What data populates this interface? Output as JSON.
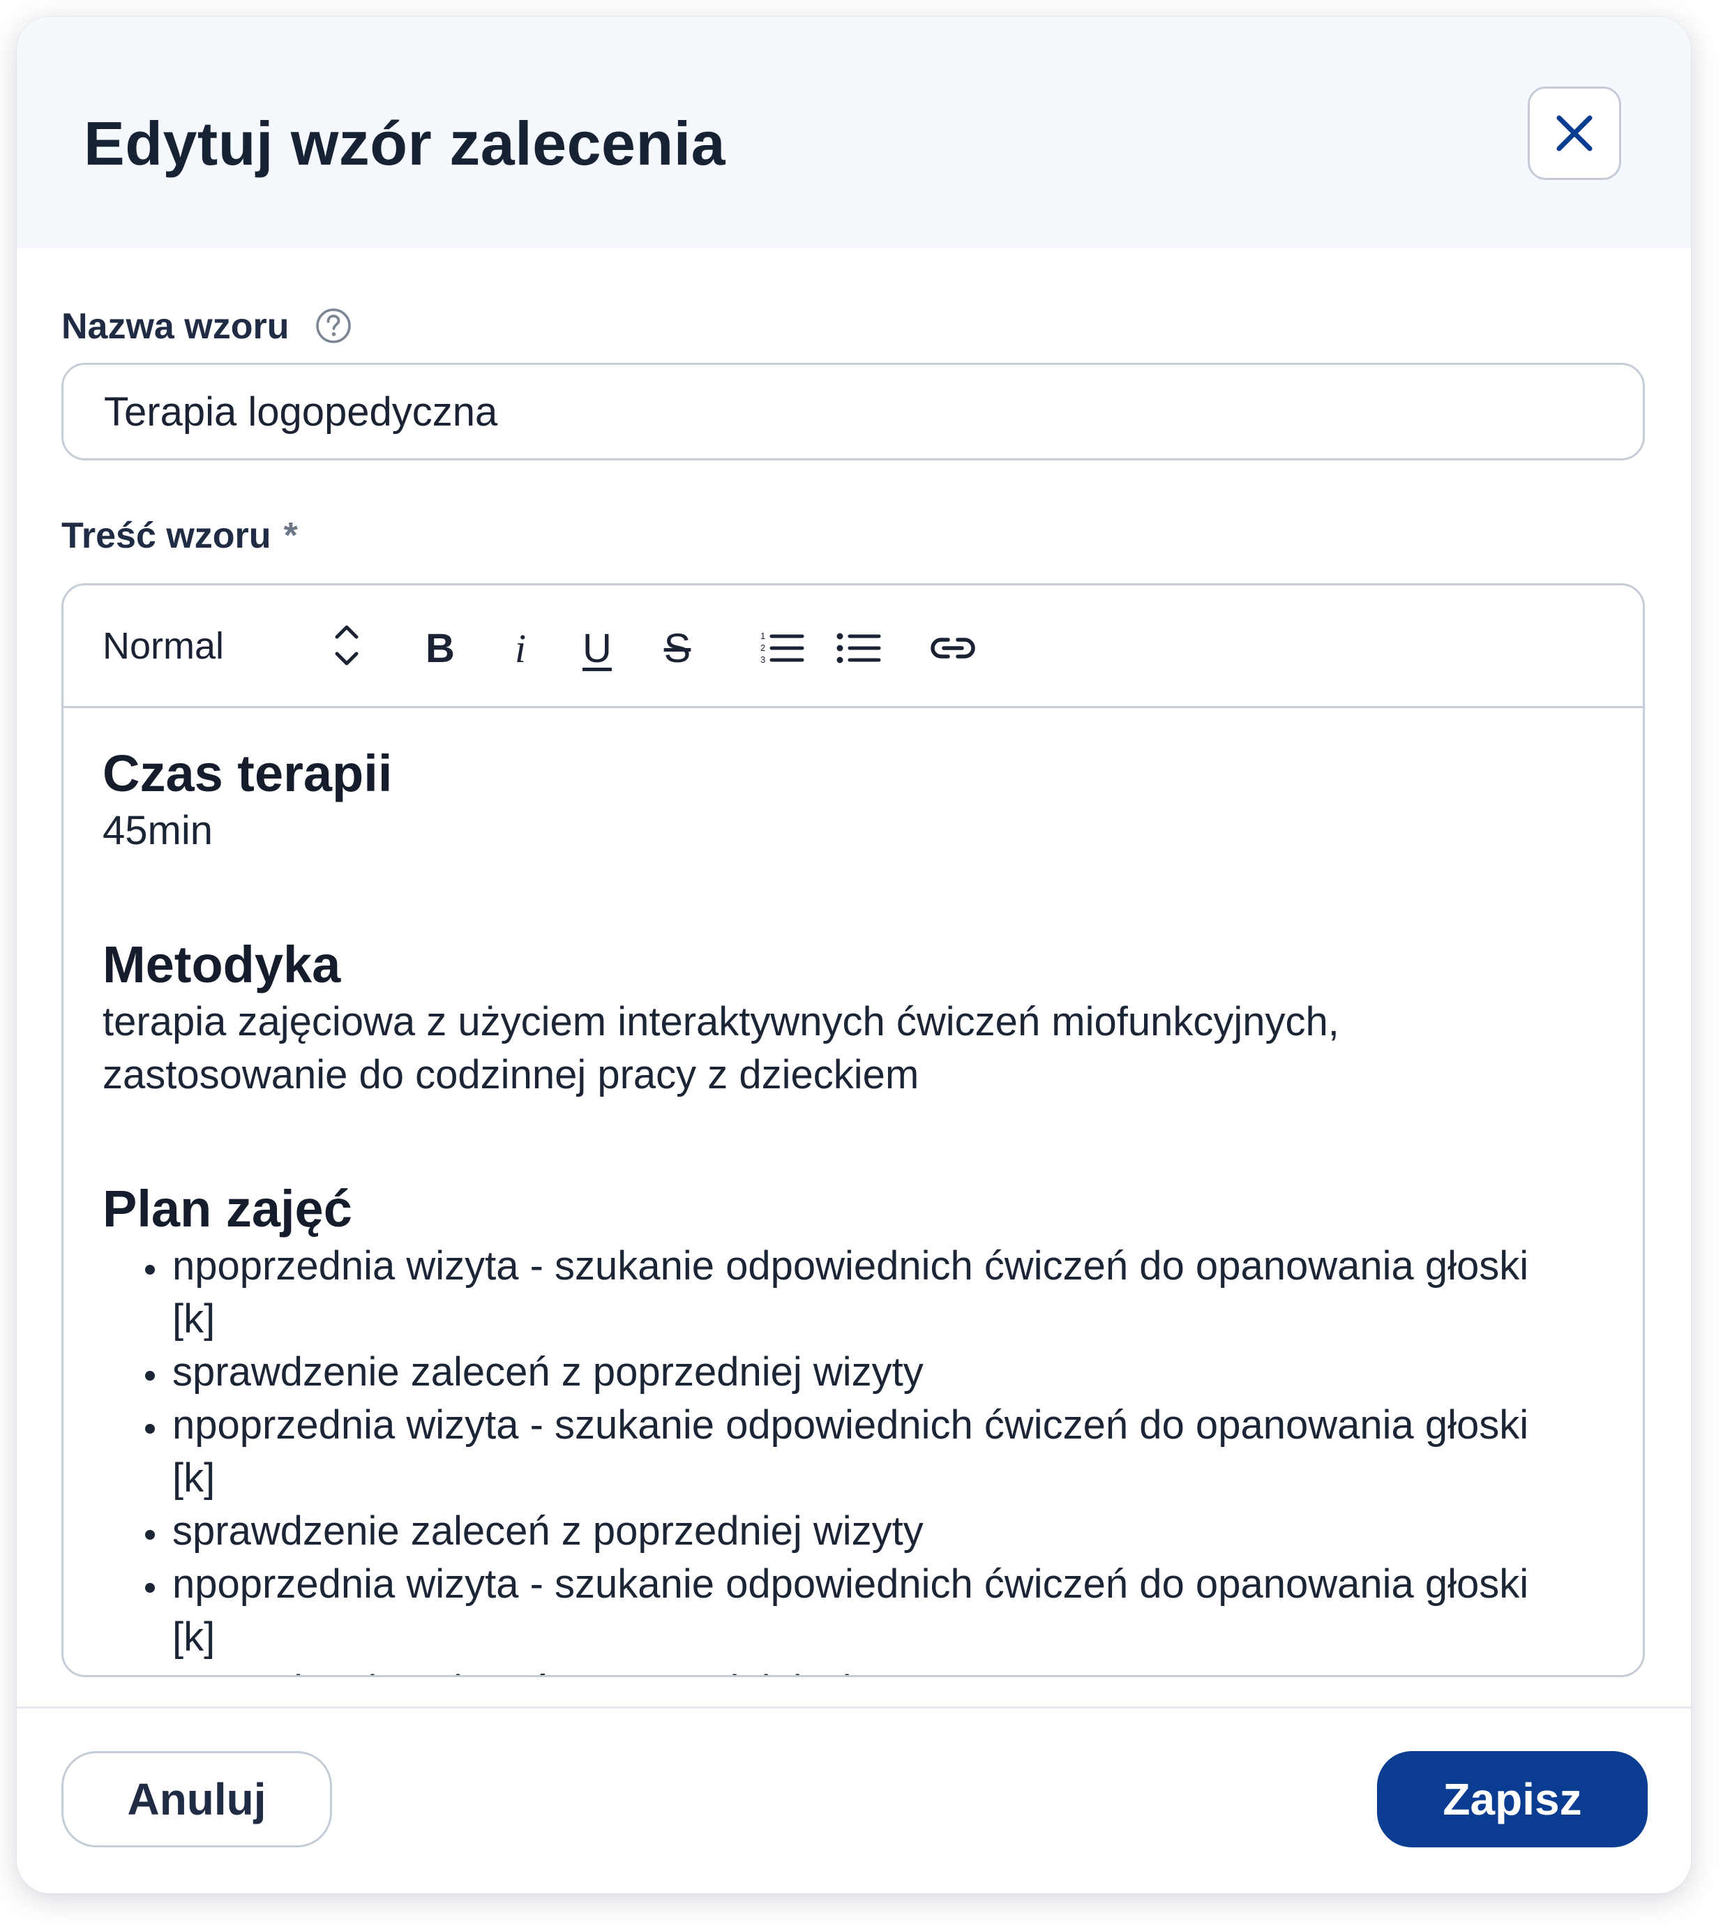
{
  "dialog": {
    "title": "Edytuj wzór zalecenia",
    "close_icon": "close-icon"
  },
  "name_field": {
    "label": "Nazwa wzoru",
    "help_icon": "question-circle-icon",
    "value": "Terapia logopedyczna"
  },
  "content_field": {
    "label": "Treść wzoru",
    "required_marker": "*"
  },
  "toolbar": {
    "format_value": "Normal",
    "bold_label": "B",
    "italic_label": "i",
    "underline_label": "U",
    "strike_label": "S",
    "icons": [
      "chevron-updown-icon",
      "ordered-list-icon",
      "bullet-list-icon",
      "link-icon"
    ]
  },
  "editor_content": {
    "section1_heading": "Czas terapii",
    "section1_text": "45min",
    "section2_heading": "Metodyka",
    "section2_text": "terapia zajęciowa z użyciem interaktywnych ćwiczeń miofunkcyjnych, zastosowanie do codzinnej pracy z dzieckiem",
    "section3_heading": "Plan zajęć",
    "plan_items": [
      "npoprzednia wizyta - szukanie odpowiednich ćwiczeń do opanowania głoski [k]",
      "sprawdzenie zaleceń z poprzedniej wizyty",
      "npoprzednia wizyta - szukanie odpowiednich ćwiczeń do opanowania głoski [k]",
      "sprawdzenie zaleceń z poprzedniej wizyty",
      "npoprzednia wizyta - szukanie odpowiednich ćwiczeń do opanowania głoski [k]",
      "sprawdzenie zaleceń z poprzedniej wizyty"
    ]
  },
  "footer": {
    "cancel_label": "Anuluj",
    "save_label": "Zapisz"
  },
  "colors": {
    "primary": "#0a3d91",
    "header_bg": "#f5f8fc",
    "border": "#c6cdd8",
    "text": "#1a2233"
  }
}
